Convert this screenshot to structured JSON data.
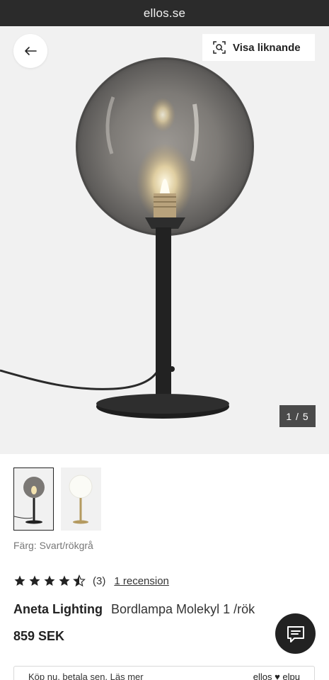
{
  "browser": {
    "url": "ellos.se"
  },
  "gallery": {
    "similar_label": "Visa liknande",
    "counter": "1 / 5",
    "current_image": 1,
    "total_images": 5
  },
  "thumbnails": [
    {
      "variant": "Svart/rökgrå",
      "selected": true
    },
    {
      "variant": "Mässing/opal",
      "selected": false
    }
  ],
  "product": {
    "color_label": "Färg:",
    "color_value": "Svart/rökgrå",
    "rating": 4.5,
    "rating_count": "(3)",
    "reviews_link": "1 recension",
    "brand": "Aneta Lighting",
    "name": "Bordlampa Molekyl 1 /rök",
    "price": "859 SEK"
  },
  "payment": {
    "text": "Köp nu, betala sen. Läs mer",
    "brand": "ellos ♥ elpu"
  },
  "icons": {
    "back": "arrow-left-icon",
    "similar": "visual-search-icon",
    "chat": "chat-icon",
    "star": "star-icon"
  },
  "colors": {
    "dark": "#222222",
    "hero_bg": "#f1f1f1",
    "url_bar": "#2b2b2b"
  }
}
